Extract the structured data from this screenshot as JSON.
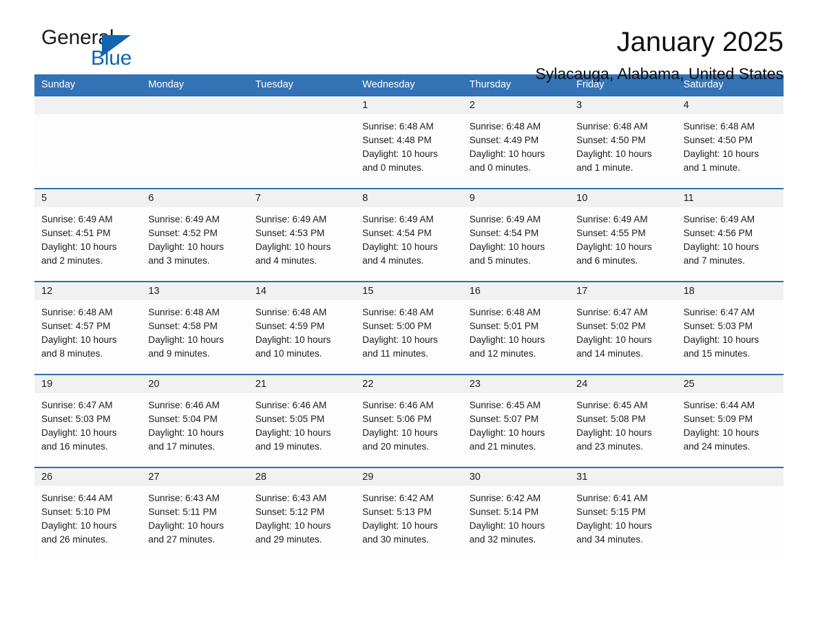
{
  "brand": {
    "line1": "General",
    "line2": "Blue",
    "triangle_color": "#1064b0"
  },
  "header": {
    "title": "January 2025",
    "subtitle": "Sylacauga, Alabama, United States"
  },
  "theme": {
    "header_blue": "#3372b5",
    "row_rule_blue": "#2b6cb0",
    "day_head_gray": "#f1f1f1",
    "text": "#1c1c1c"
  },
  "weekdays": [
    "Sunday",
    "Monday",
    "Tuesday",
    "Wednesday",
    "Thursday",
    "Friday",
    "Saturday"
  ],
  "weeks": [
    [
      {
        "date": "",
        "sunrise": "",
        "sunset": "",
        "daylight": "",
        "empty": true
      },
      {
        "date": "",
        "sunrise": "",
        "sunset": "",
        "daylight": "",
        "empty": true
      },
      {
        "date": "",
        "sunrise": "",
        "sunset": "",
        "daylight": "",
        "empty": true
      },
      {
        "date": "1",
        "sunrise": "Sunrise: 6:48 AM",
        "sunset": "Sunset: 4:48 PM",
        "daylight": "Daylight: 10 hours and 0 minutes."
      },
      {
        "date": "2",
        "sunrise": "Sunrise: 6:48 AM",
        "sunset": "Sunset: 4:49 PM",
        "daylight": "Daylight: 10 hours and 0 minutes."
      },
      {
        "date": "3",
        "sunrise": "Sunrise: 6:48 AM",
        "sunset": "Sunset: 4:50 PM",
        "daylight": "Daylight: 10 hours and 1 minute."
      },
      {
        "date": "4",
        "sunrise": "Sunrise: 6:48 AM",
        "sunset": "Sunset: 4:50 PM",
        "daylight": "Daylight: 10 hours and 1 minute."
      }
    ],
    [
      {
        "date": "5",
        "sunrise": "Sunrise: 6:49 AM",
        "sunset": "Sunset: 4:51 PM",
        "daylight": "Daylight: 10 hours and 2 minutes."
      },
      {
        "date": "6",
        "sunrise": "Sunrise: 6:49 AM",
        "sunset": "Sunset: 4:52 PM",
        "daylight": "Daylight: 10 hours and 3 minutes."
      },
      {
        "date": "7",
        "sunrise": "Sunrise: 6:49 AM",
        "sunset": "Sunset: 4:53 PM",
        "daylight": "Daylight: 10 hours and 4 minutes."
      },
      {
        "date": "8",
        "sunrise": "Sunrise: 6:49 AM",
        "sunset": "Sunset: 4:54 PM",
        "daylight": "Daylight: 10 hours and 4 minutes."
      },
      {
        "date": "9",
        "sunrise": "Sunrise: 6:49 AM",
        "sunset": "Sunset: 4:54 PM",
        "daylight": "Daylight: 10 hours and 5 minutes."
      },
      {
        "date": "10",
        "sunrise": "Sunrise: 6:49 AM",
        "sunset": "Sunset: 4:55 PM",
        "daylight": "Daylight: 10 hours and 6 minutes."
      },
      {
        "date": "11",
        "sunrise": "Sunrise: 6:49 AM",
        "sunset": "Sunset: 4:56 PM",
        "daylight": "Daylight: 10 hours and 7 minutes."
      }
    ],
    [
      {
        "date": "12",
        "sunrise": "Sunrise: 6:48 AM",
        "sunset": "Sunset: 4:57 PM",
        "daylight": "Daylight: 10 hours and 8 minutes."
      },
      {
        "date": "13",
        "sunrise": "Sunrise: 6:48 AM",
        "sunset": "Sunset: 4:58 PM",
        "daylight": "Daylight: 10 hours and 9 minutes."
      },
      {
        "date": "14",
        "sunrise": "Sunrise: 6:48 AM",
        "sunset": "Sunset: 4:59 PM",
        "daylight": "Daylight: 10 hours and 10 minutes."
      },
      {
        "date": "15",
        "sunrise": "Sunrise: 6:48 AM",
        "sunset": "Sunset: 5:00 PM",
        "daylight": "Daylight: 10 hours and 11 minutes."
      },
      {
        "date": "16",
        "sunrise": "Sunrise: 6:48 AM",
        "sunset": "Sunset: 5:01 PM",
        "daylight": "Daylight: 10 hours and 12 minutes."
      },
      {
        "date": "17",
        "sunrise": "Sunrise: 6:47 AM",
        "sunset": "Sunset: 5:02 PM",
        "daylight": "Daylight: 10 hours and 14 minutes."
      },
      {
        "date": "18",
        "sunrise": "Sunrise: 6:47 AM",
        "sunset": "Sunset: 5:03 PM",
        "daylight": "Daylight: 10 hours and 15 minutes."
      }
    ],
    [
      {
        "date": "19",
        "sunrise": "Sunrise: 6:47 AM",
        "sunset": "Sunset: 5:03 PM",
        "daylight": "Daylight: 10 hours and 16 minutes."
      },
      {
        "date": "20",
        "sunrise": "Sunrise: 6:46 AM",
        "sunset": "Sunset: 5:04 PM",
        "daylight": "Daylight: 10 hours and 17 minutes."
      },
      {
        "date": "21",
        "sunrise": "Sunrise: 6:46 AM",
        "sunset": "Sunset: 5:05 PM",
        "daylight": "Daylight: 10 hours and 19 minutes."
      },
      {
        "date": "22",
        "sunrise": "Sunrise: 6:46 AM",
        "sunset": "Sunset: 5:06 PM",
        "daylight": "Daylight: 10 hours and 20 minutes."
      },
      {
        "date": "23",
        "sunrise": "Sunrise: 6:45 AM",
        "sunset": "Sunset: 5:07 PM",
        "daylight": "Daylight: 10 hours and 21 minutes."
      },
      {
        "date": "24",
        "sunrise": "Sunrise: 6:45 AM",
        "sunset": "Sunset: 5:08 PM",
        "daylight": "Daylight: 10 hours and 23 minutes."
      },
      {
        "date": "25",
        "sunrise": "Sunrise: 6:44 AM",
        "sunset": "Sunset: 5:09 PM",
        "daylight": "Daylight: 10 hours and 24 minutes."
      }
    ],
    [
      {
        "date": "26",
        "sunrise": "Sunrise: 6:44 AM",
        "sunset": "Sunset: 5:10 PM",
        "daylight": "Daylight: 10 hours and 26 minutes."
      },
      {
        "date": "27",
        "sunrise": "Sunrise: 6:43 AM",
        "sunset": "Sunset: 5:11 PM",
        "daylight": "Daylight: 10 hours and 27 minutes."
      },
      {
        "date": "28",
        "sunrise": "Sunrise: 6:43 AM",
        "sunset": "Sunset: 5:12 PM",
        "daylight": "Daylight: 10 hours and 29 minutes."
      },
      {
        "date": "29",
        "sunrise": "Sunrise: 6:42 AM",
        "sunset": "Sunset: 5:13 PM",
        "daylight": "Daylight: 10 hours and 30 minutes."
      },
      {
        "date": "30",
        "sunrise": "Sunrise: 6:42 AM",
        "sunset": "Sunset: 5:14 PM",
        "daylight": "Daylight: 10 hours and 32 minutes."
      },
      {
        "date": "31",
        "sunrise": "Sunrise: 6:41 AM",
        "sunset": "Sunset: 5:15 PM",
        "daylight": "Daylight: 10 hours and 34 minutes."
      },
      {
        "date": "",
        "sunrise": "",
        "sunset": "",
        "daylight": "",
        "empty": true
      }
    ]
  ]
}
